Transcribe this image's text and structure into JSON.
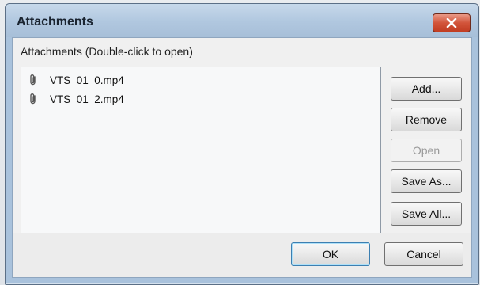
{
  "dialog": {
    "title": "Attachments",
    "list_label": "Attachments (Double-click to open)",
    "items": [
      {
        "name": "VTS_01_0.mp4",
        "icon": "paperclip-icon"
      },
      {
        "name": "VTS_01_2.mp4",
        "icon": "paperclip-icon"
      }
    ],
    "buttons": {
      "add": "Add...",
      "remove": "Remove",
      "open": "Open",
      "save_as": "Save As...",
      "save_all": "Save All...",
      "ok": "OK",
      "cancel": "Cancel"
    }
  },
  "colors": {
    "titlebar": "#b0c7df",
    "close_button": "#d2543a",
    "default_button_border": "#3c7fb1"
  }
}
